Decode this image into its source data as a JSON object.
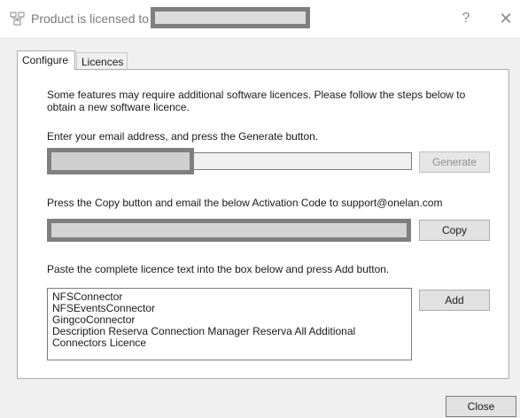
{
  "window": {
    "title": "Product is licensed to",
    "help_label": "?",
    "close_label": "✕"
  },
  "tabs": [
    {
      "label": "Configure",
      "active": true
    },
    {
      "label": "Licences",
      "active": false
    }
  ],
  "configure": {
    "intro": "Some features may require additional software licences.  Please follow the steps below to obtain a new software licence.",
    "step1": "Enter your email address, and press the Generate button.",
    "generate_label": "Generate",
    "step2": "Press the Copy button and email the below Activation Code to support@onelan.com",
    "copy_label": "Copy",
    "step3": "Paste the complete licence text into the box below and press Add button.",
    "licence_lines": [
      "NFSConnector",
      "NFSEventsConnector",
      "GingcoConnector",
      "Description Reserva Connection Manager Reserva All Additional",
      "Connectors Licence"
    ],
    "add_label": "Add"
  },
  "footer": {
    "close_label": "Close"
  },
  "icons": {
    "app": "network-icon"
  },
  "colors": {
    "redaction_border": "#7f7f7f",
    "redaction_fill": "#d4d4d4"
  }
}
